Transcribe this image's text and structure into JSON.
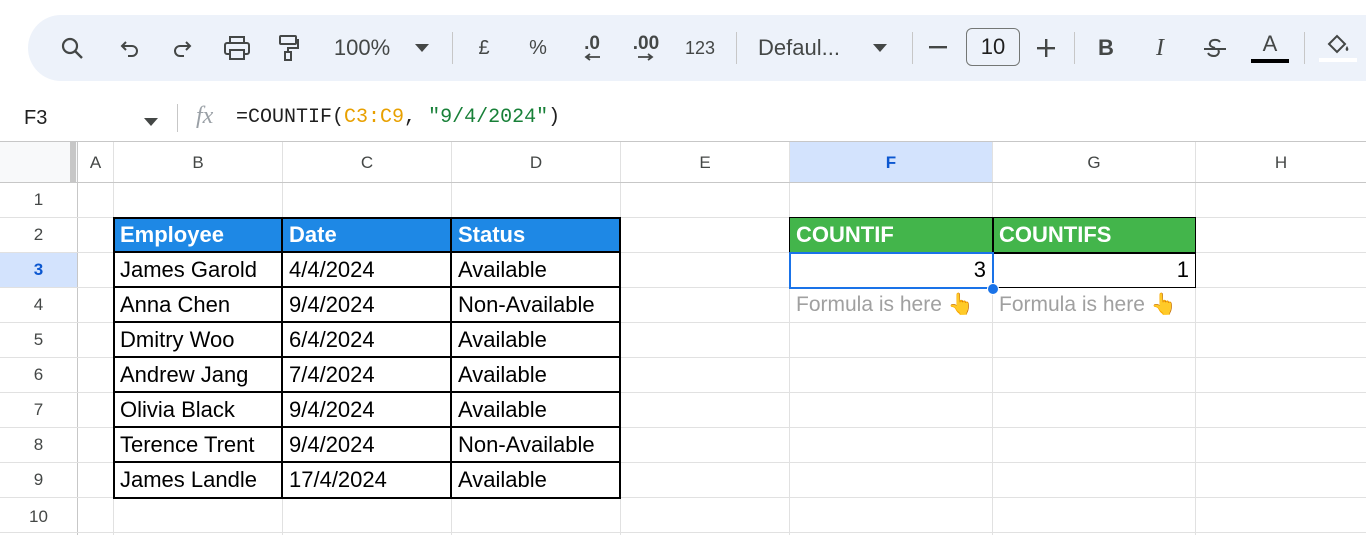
{
  "toolbar": {
    "zoom": "100%",
    "currency": "£",
    "percent": "%",
    "dec_decrease": ".0",
    "dec_increase": ".00",
    "number_format": "123",
    "font_name": "Defaul...",
    "font_size": "10",
    "bold": "B",
    "italic": "I",
    "text_color": "A",
    "accent": "#edf2fa"
  },
  "formula_bar": {
    "name_box": "F3",
    "fx": "fx",
    "formula_prefix": "=COUNTIF(",
    "formula_range": "C3:C9",
    "formula_sep": ", ",
    "formula_criteria": "\"9/4/2024\"",
    "formula_suffix": ")"
  },
  "columns": [
    "A",
    "B",
    "C",
    "D",
    "E",
    "F",
    "G",
    "H"
  ],
  "rows": [
    "1",
    "2",
    "3",
    "4",
    "5",
    "6",
    "7",
    "8",
    "9",
    "10"
  ],
  "table": {
    "headers": [
      "Employee",
      "Date",
      "Status"
    ],
    "rows": [
      [
        "James Garold",
        "4/4/2024",
        "Available"
      ],
      [
        "Anna Chen",
        "9/4/2024",
        "Non-Available"
      ],
      [
        "Dmitry Woo",
        "6/4/2024",
        "Available"
      ],
      [
        "Andrew Jang",
        "7/4/2024",
        "Available"
      ],
      [
        "Olivia Black",
        "9/4/2024",
        "Available"
      ],
      [
        "Terence Trent",
        "9/4/2024",
        "Non-Available"
      ],
      [
        "James Landle",
        "17/4/2024",
        "Available"
      ]
    ],
    "header_color": "#1e88e5"
  },
  "results": {
    "countif_header": "COUNTIF",
    "countifs_header": "COUNTIFS",
    "countif_value": "3",
    "countifs_value": "1",
    "note_f": "Formula is here 👆",
    "note_g": "Formula is here 👆",
    "header_color": "#43b54b"
  }
}
